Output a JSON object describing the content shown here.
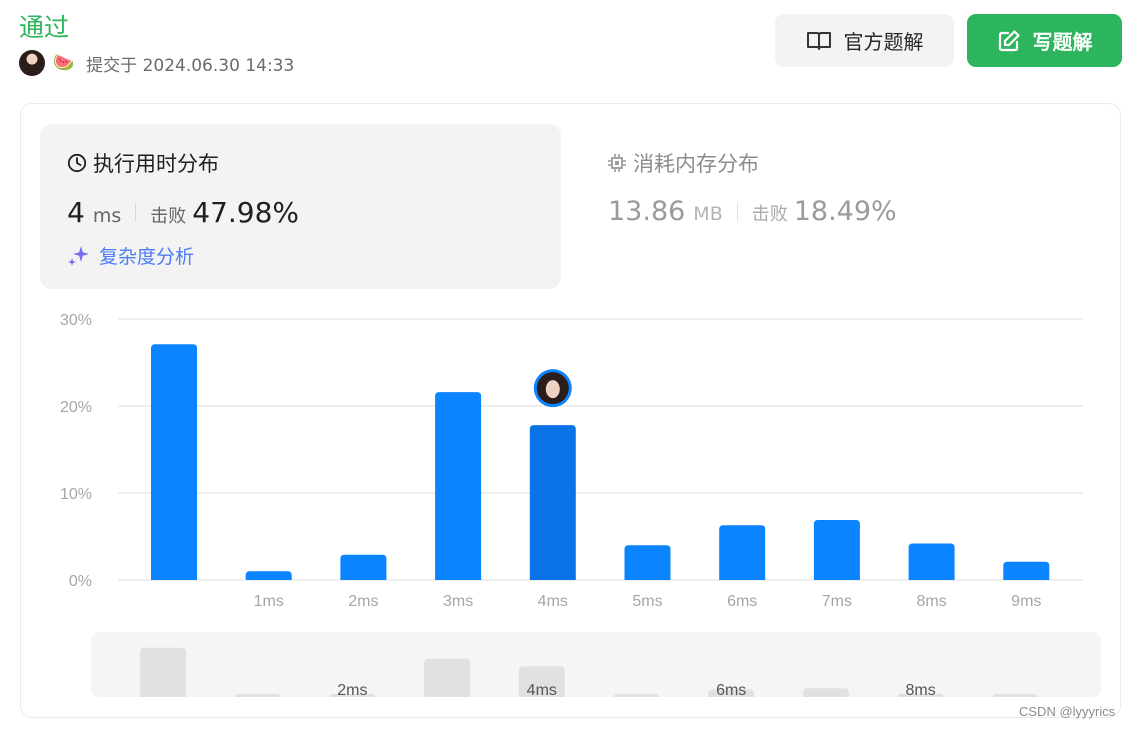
{
  "header": {
    "status": "通过",
    "submitted_text": "提交于 2024.06.30 14:33",
    "badge_emoji": "🍉",
    "official_solution_label": "官方题解",
    "write_solution_label": "写题解"
  },
  "runtime": {
    "title": "执行用时分布",
    "value": "4",
    "unit": "ms",
    "beat_label": "击败",
    "beat_percent": "47.98%",
    "complexity_label": "复杂度分析"
  },
  "memory": {
    "title": "消耗内存分布",
    "value": "13.86",
    "unit": "MB",
    "beat_label": "击败",
    "beat_percent": "18.49%"
  },
  "colors": {
    "accent_green": "#2db55d",
    "bar_blue": "#0a84ff",
    "bar_selected": "#0a73e6",
    "mini_bar": "#e1e1e1"
  },
  "chart_data": {
    "type": "bar",
    "categories": [
      "",
      "1ms",
      "2ms",
      "3ms",
      "4ms",
      "5ms",
      "6ms",
      "7ms",
      "8ms",
      "9ms"
    ],
    "values": [
      27.1,
      1.0,
      2.9,
      21.6,
      17.8,
      4.0,
      6.3,
      6.9,
      4.2,
      2.1
    ],
    "selected_index": 4,
    "ylim": [
      0,
      30
    ],
    "yticks": [
      0,
      10,
      20,
      30
    ],
    "ytick_labels": [
      "0%",
      "10%",
      "20%",
      "30%"
    ],
    "grid": true,
    "title": "",
    "xlabel": "",
    "ylabel": ""
  },
  "mini_chart": {
    "labels": [
      "",
      "",
      "2ms",
      "",
      "4ms",
      "",
      "6ms",
      "",
      "8ms",
      ""
    ]
  },
  "watermark": "CSDN @lyyyrics"
}
